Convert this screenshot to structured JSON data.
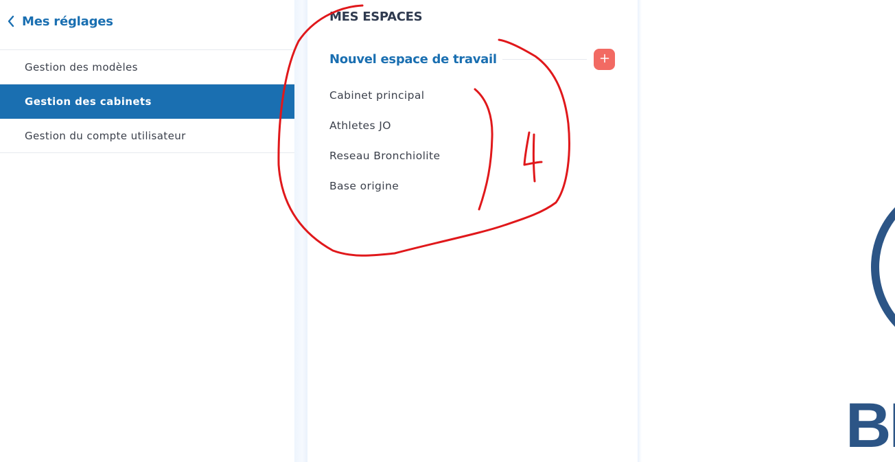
{
  "settings": {
    "back_label": "Mes réglages",
    "menu_items": [
      {
        "label": "Gestion des modèles",
        "active": false
      },
      {
        "label": "Gestion des cabinets",
        "active": true
      },
      {
        "label": "Gestion du compte utilisateur",
        "active": false
      }
    ]
  },
  "spaces": {
    "title": "MES ESPACES",
    "new_space_label": "Nouvel espace de travail",
    "add_icon": "plus-icon",
    "items": [
      {
        "label": "Cabinet principal"
      },
      {
        "label": "Athletes JO"
      },
      {
        "label": "Reseau Bronchiolite"
      },
      {
        "label": "Base origine"
      }
    ]
  },
  "logo": {
    "text": "BI"
  },
  "annotation": {
    "text": "4",
    "color": "#e0181b"
  },
  "colors": {
    "brand": "#1a6fb1",
    "heading": "#2f3a4f",
    "accent": "#f26a63",
    "logo": "#2c5586"
  }
}
